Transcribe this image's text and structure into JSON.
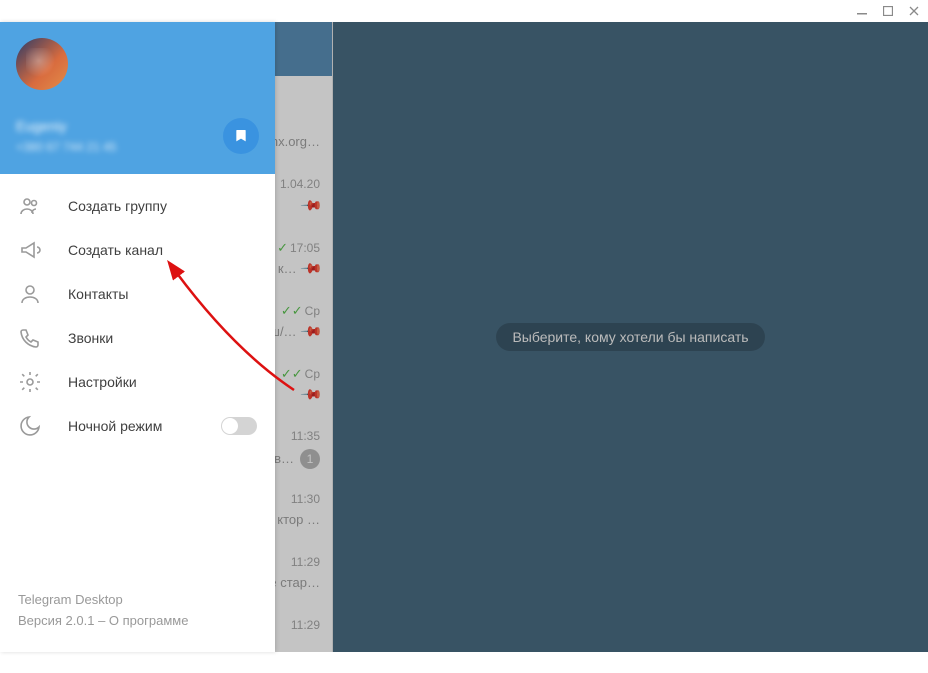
{
  "profile": {
    "name": "Eugeniy",
    "phone": "+380 67 744 21 45"
  },
  "bookmarkIcon": "bookmark",
  "menu": [
    {
      "icon": "group",
      "label": "Создать группу"
    },
    {
      "icon": "channel",
      "label": "Создать канал"
    },
    {
      "icon": "contacts",
      "label": "Контакты"
    },
    {
      "icon": "calls",
      "label": "Звонки"
    },
    {
      "icon": "settings",
      "label": "Настройки"
    },
    {
      "icon": "night",
      "label": "Ночной режим",
      "toggle": true,
      "toggleOn": false
    }
  ],
  "footer": {
    "appName": "Telegram Desktop",
    "version": "Версия 2.0.1 – О программе"
  },
  "mainPlaceholder": "Выберите, кому хотели бы написать",
  "chats": [
    {
      "time": "",
      "preview": "nx.org…",
      "ticks": false,
      "pin": false
    },
    {
      "time": "1.04.20",
      "preview": "",
      "ticks": false,
      "pin": true
    },
    {
      "time": "17:05",
      "preview": "к…",
      "ticks": true,
      "pin": true
    },
    {
      "time": "Ср",
      "preview": "ш/…",
      "ticks": true,
      "pin": true
    },
    {
      "time": "Ср",
      "preview": "",
      "ticks": true,
      "pin": true
    },
    {
      "time": "11:35",
      "preview": "ав…",
      "ticks": false,
      "badge": "1"
    },
    {
      "time": "11:30",
      "preview": "ктор …"
    },
    {
      "time": "11:29",
      "preview": "е  стар…"
    },
    {
      "time": "11:29",
      "preview": ""
    }
  ],
  "colors": {
    "accent": "#4fa3e2",
    "mainBg": "#496c82"
  }
}
